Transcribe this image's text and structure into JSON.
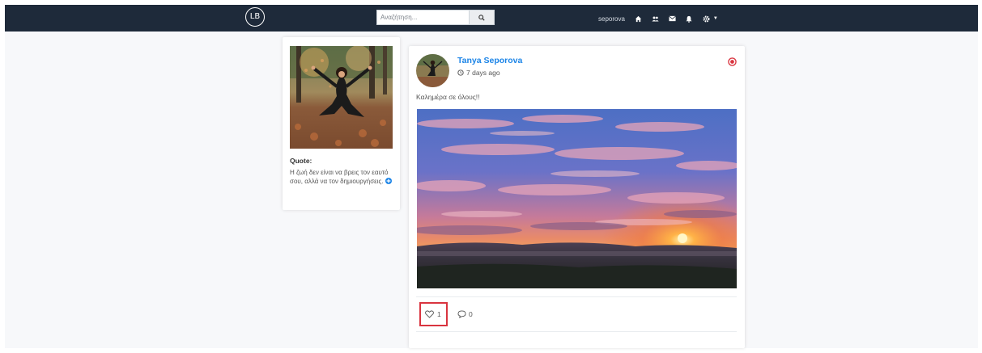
{
  "navbar": {
    "logo_text": "LB",
    "search_placeholder": "Αναζήτηση...",
    "username": "seporova",
    "icons": [
      "home-icon",
      "users-icon",
      "envelope-icon",
      "bell-icon",
      "gear-icon"
    ]
  },
  "profile": {
    "quote_title": "Quote:",
    "quote_text": "Η ζωή δεν είναι να βρεις τον εαυτό σου, αλλά να τον δημιουργήσεις."
  },
  "post": {
    "author": "Tanya Seporova",
    "time_ago": "7 days ago",
    "text": "Καλημέρα σε όλους!!",
    "likes": "1",
    "comments": "0"
  },
  "colors": {
    "navbar": "#1e2a3a",
    "link": "#1b84e7",
    "danger": "#d9343f",
    "background": "#f7f8fa"
  }
}
